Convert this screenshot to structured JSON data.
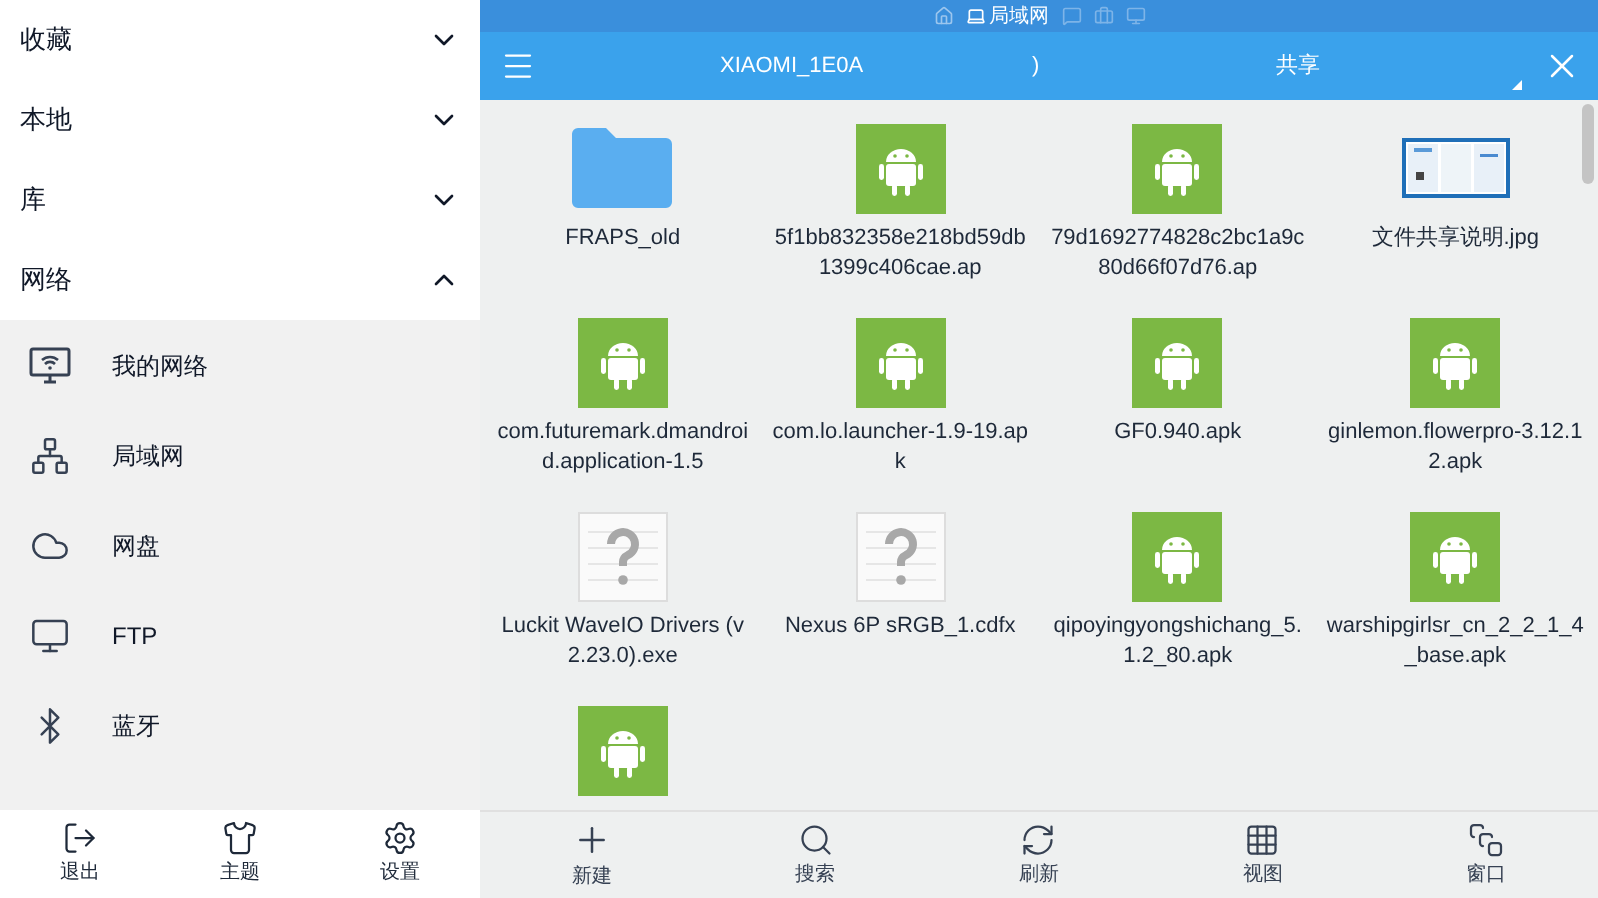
{
  "sidebar": {
    "sections": [
      {
        "label": "收藏",
        "expanded": false
      },
      {
        "label": "本地",
        "expanded": false
      },
      {
        "label": "库",
        "expanded": false
      },
      {
        "label": "网络",
        "expanded": true,
        "items": [
          {
            "kind": "wifi-monitor",
            "label": "我的网络"
          },
          {
            "kind": "lan",
            "label": "局域网"
          },
          {
            "kind": "cloud",
            "label": "网盘"
          },
          {
            "kind": "ftp",
            "label": "FTP"
          },
          {
            "kind": "bluetooth",
            "label": "蓝牙"
          }
        ]
      }
    ],
    "bottom_buttons": [
      {
        "kind": "exit",
        "label": "退出"
      },
      {
        "kind": "theme",
        "label": "主题"
      },
      {
        "kind": "settings",
        "label": "设置"
      }
    ]
  },
  "status_strip": {
    "label": "局域网"
  },
  "path_bar": {
    "segments": [
      "XIAOMI_1E0A",
      ")",
      "共享"
    ]
  },
  "files": [
    {
      "kind": "folder",
      "name": "FRAPS_old"
    },
    {
      "kind": "apk",
      "name": "5f1bb832358e218bd59db1399c406cae.ap"
    },
    {
      "kind": "apk",
      "name": "79d1692774828c2bc1a9c80d66f07d76.ap"
    },
    {
      "kind": "image",
      "name": "文件共享说明.jpg"
    },
    {
      "kind": "apk",
      "name": "com.futuremark.dmandroid.application-1.5"
    },
    {
      "kind": "apk",
      "name": "com.lo.launcher-1.9-19.apk"
    },
    {
      "kind": "apk",
      "name": "GF0.940.apk"
    },
    {
      "kind": "apk",
      "name": "ginlemon.flowerpro-3.12.12.apk"
    },
    {
      "kind": "unknown",
      "name": "Luckit WaveIO Drivers (v2.23.0).exe"
    },
    {
      "kind": "unknown",
      "name": "Nexus 6P sRGB_1.cdfx"
    },
    {
      "kind": "apk",
      "name": "qipoyingyongshichang_5.1.2_80.apk"
    },
    {
      "kind": "apk",
      "name": "warshipgirlsr_cn_2_2_1_4_base.apk"
    },
    {
      "kind": "apk"
    }
  ],
  "toolbar": [
    {
      "kind": "new",
      "label": "新建"
    },
    {
      "kind": "search",
      "label": "搜索"
    },
    {
      "kind": "refresh",
      "label": "刷新"
    },
    {
      "kind": "view",
      "label": "视图"
    },
    {
      "kind": "window",
      "label": "窗口"
    }
  ]
}
